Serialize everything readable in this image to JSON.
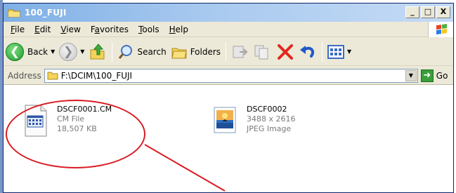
{
  "window": {
    "title": "100_FUJI",
    "controls": {
      "minimize": "_",
      "maximize": "□",
      "close": "X"
    }
  },
  "menu": [
    {
      "label": "File",
      "key": "F",
      "rest": "ile"
    },
    {
      "label": "Edit",
      "key": "E",
      "rest": "dit"
    },
    {
      "label": "View",
      "key": "V",
      "rest": "iew"
    },
    {
      "label": "Favorites",
      "key": "a",
      "pre": "F",
      "rest": "vorites"
    },
    {
      "label": "Tools",
      "key": "T",
      "rest": "ools"
    },
    {
      "label": "Help",
      "key": "H",
      "rest": "elp"
    }
  ],
  "toolbar": {
    "back_label": "Back",
    "search_label": "Search",
    "folders_label": "Folders"
  },
  "address": {
    "label": "Address",
    "value": "F:\\DCIM\\100_FUJI",
    "go_label": "Go"
  },
  "files": [
    {
      "name": "DSCF0001.CM",
      "type": "CM File",
      "size": "18,507 KB"
    },
    {
      "name": "DSCF0002",
      "dims": "3488 x 2616",
      "type": "JPEG Image"
    }
  ],
  "colors": {
    "annotation": "#d81b22",
    "titlebar": "#7fb0e6",
    "chrome": "#ece9d8"
  }
}
